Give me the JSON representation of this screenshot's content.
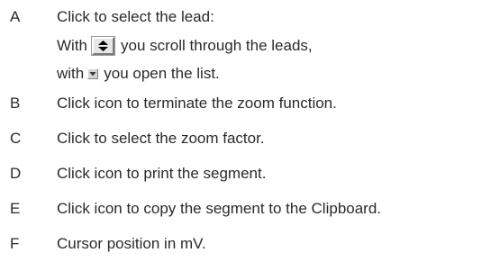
{
  "items": [
    {
      "key": "A",
      "text": "Click to select the lead:",
      "sub1_pre": "With",
      "sub1_post": "you scroll through the leads,",
      "sub2_pre": "with",
      "sub2_post": "you open the list.",
      "icons": [
        "scroll-up-down-icon",
        "dropdown-arrow-icon"
      ]
    },
    {
      "key": "B",
      "text": "Click icon to terminate the zoom function."
    },
    {
      "key": "C",
      "text": "Click to select the zoom factor."
    },
    {
      "key": "D",
      "text": "Click icon to print the segment."
    },
    {
      "key": "E",
      "text": "Click icon to copy the segment to the Clipboard."
    },
    {
      "key": "F",
      "text": "Cursor position in mV."
    }
  ]
}
